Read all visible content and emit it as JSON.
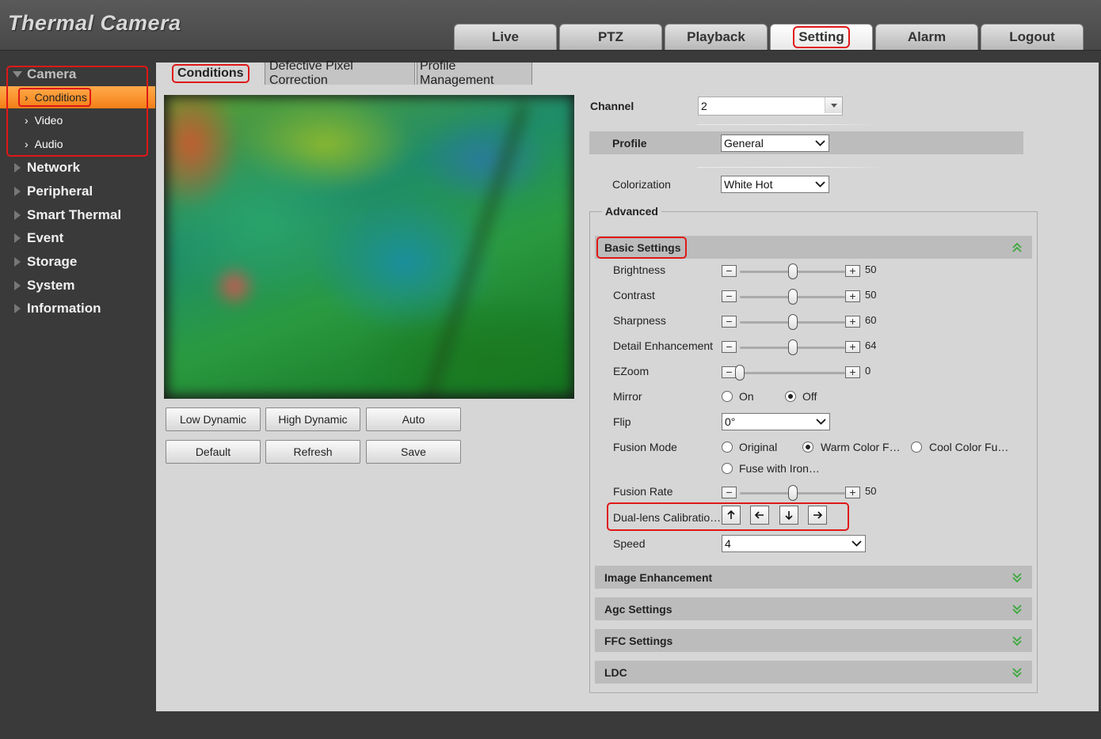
{
  "app": {
    "title": "Thermal Camera"
  },
  "topnav": {
    "tabs": [
      {
        "label": "Live"
      },
      {
        "label": "PTZ"
      },
      {
        "label": "Playback"
      },
      {
        "label": "Setting"
      },
      {
        "label": "Alarm"
      },
      {
        "label": "Logout"
      }
    ],
    "active": "Setting"
  },
  "sidebar": {
    "camera": {
      "label": "Camera",
      "items": [
        {
          "label": "Conditions"
        },
        {
          "label": "Video"
        },
        {
          "label": "Audio"
        }
      ],
      "active": "Conditions"
    },
    "groups": [
      {
        "label": "Network"
      },
      {
        "label": "Peripheral"
      },
      {
        "label": "Smart Thermal"
      },
      {
        "label": "Event"
      },
      {
        "label": "Storage"
      },
      {
        "label": "System"
      },
      {
        "label": "Information"
      }
    ]
  },
  "subtabs": [
    {
      "label": "Conditions"
    },
    {
      "label": "Defective Pixel Correction"
    },
    {
      "label": "Profile Management"
    }
  ],
  "buttons": {
    "low_dynamic": "Low Dynamic",
    "high_dynamic": "High Dynamic",
    "auto": "Auto",
    "default": "Default",
    "refresh": "Refresh",
    "save": "Save"
  },
  "settings": {
    "channel": {
      "label": "Channel",
      "value": "2"
    },
    "profile": {
      "label": "Profile",
      "value": "General"
    },
    "colorization": {
      "label": "Colorization",
      "value": "White Hot"
    },
    "advanced_label": "Advanced",
    "basic_settings_label": "Basic Settings",
    "sliders": [
      {
        "label": "Brightness",
        "value": "50",
        "level": 0.5
      },
      {
        "label": "Contrast",
        "value": "50",
        "level": 0.5
      },
      {
        "label": "Sharpness",
        "value": "60",
        "level": 0.5
      },
      {
        "label": "Detail Enhancement",
        "value": "64",
        "level": 0.5
      },
      {
        "label": "EZoom",
        "value": "0",
        "level": 0.0
      }
    ],
    "mirror": {
      "label": "Mirror",
      "on": "On",
      "off": "Off",
      "selected": "Off"
    },
    "flip": {
      "label": "Flip",
      "value": "0°"
    },
    "fusion_mode": {
      "label": "Fusion Mode",
      "options": [
        "Original",
        "Warm Color F…",
        "Cool Color Fu…",
        "Fuse with Iron…"
      ],
      "selected": "Warm Color F…"
    },
    "fusion_rate": {
      "label": "Fusion Rate",
      "value": "50",
      "level": 0.5
    },
    "dual_lens": {
      "label": "Dual-lens Calibratio…"
    },
    "speed": {
      "label": "Speed",
      "value": "4"
    },
    "collapsed_sections": [
      {
        "label": "Image Enhancement"
      },
      {
        "label": "Agc Settings"
      },
      {
        "label": "FFC Settings"
      },
      {
        "label": "LDC"
      }
    ]
  },
  "colors": {
    "accent_orange": "#f57f17",
    "highlight_red": "#e01818",
    "chevron_green": "#3aa83a"
  }
}
